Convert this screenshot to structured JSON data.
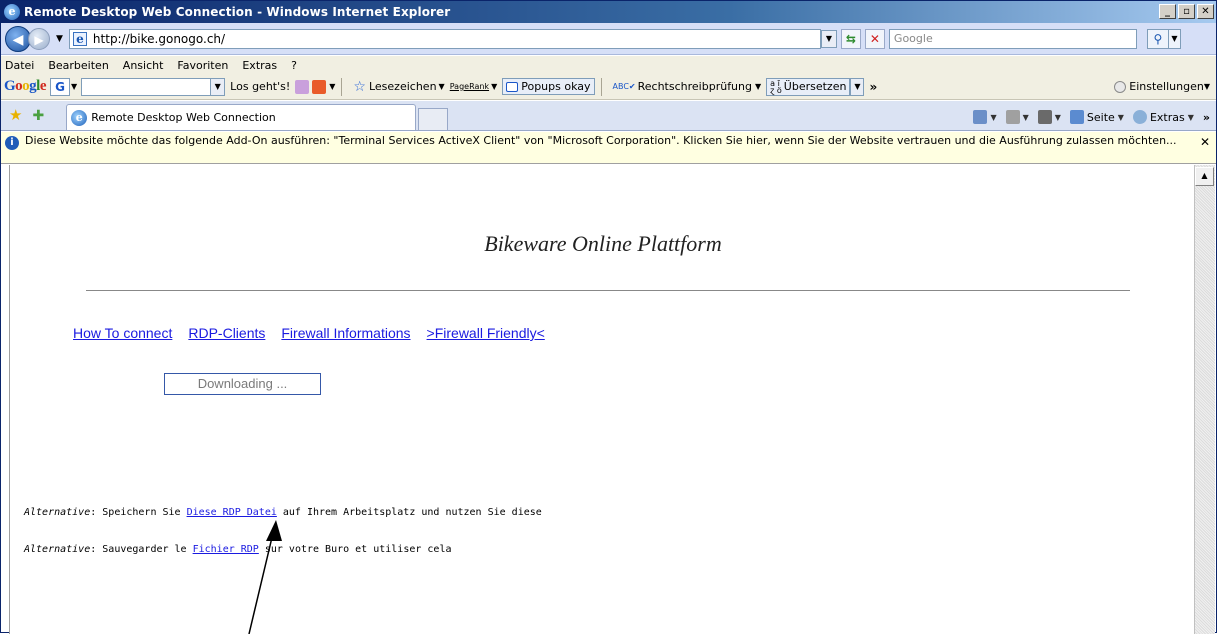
{
  "window": {
    "title": "Remote Desktop Web Connection - Windows Internet Explorer",
    "min": "_",
    "max": "▫",
    "close": "✕"
  },
  "address": {
    "url": "http://bike.gonogo.ch/",
    "search_placeholder": "Google"
  },
  "menu": [
    "Datei",
    "Bearbeiten",
    "Ansicht",
    "Favoriten",
    "Extras",
    "?"
  ],
  "google_toolbar": {
    "go_label": "Los geht's!",
    "bookmarks_label": "Lesezeichen",
    "pagerank_label": "PageRank",
    "popups_label": "Popups okay",
    "spellcheck_label": "Rechtschreibprüfung",
    "translate_label": "Übersetzen",
    "settings_label": "Einstellungen"
  },
  "tab": {
    "title": "Remote Desktop Web Connection"
  },
  "command_bar": {
    "page_label": "Seite",
    "extras_label": "Extras"
  },
  "infobar": {
    "message": "Diese Website möchte das folgende Add-On ausführen: \"Terminal Services ActiveX Client\" von \"Microsoft Corporation\". Klicken Sie hier, wenn Sie der Website vertrauen und die Ausführung zulassen möchten..."
  },
  "page": {
    "title": "Bikeware  Online Plattform",
    "links": [
      "How To connect",
      "RDP-Clients",
      "Firewall Informations",
      ">Firewall Friendly<"
    ],
    "download_status": "Downloading ...",
    "alt1": {
      "prefix": "Alternative",
      "before": ": Speichern Sie  ",
      "link": "Diese RDP Datei",
      "after": " auf Ihrem Arbeitsplatz und nutzen Sie diese"
    },
    "alt2": {
      "prefix": "Alternative",
      "before": ": Sauvegarder le ",
      "link": "Fichier RDP",
      "after": " sur votre Buro et utiliser cela"
    }
  },
  "colors": {
    "link": "#1a1ae0",
    "titlebar": "#0a246a",
    "infobar": "#ffffe1"
  }
}
